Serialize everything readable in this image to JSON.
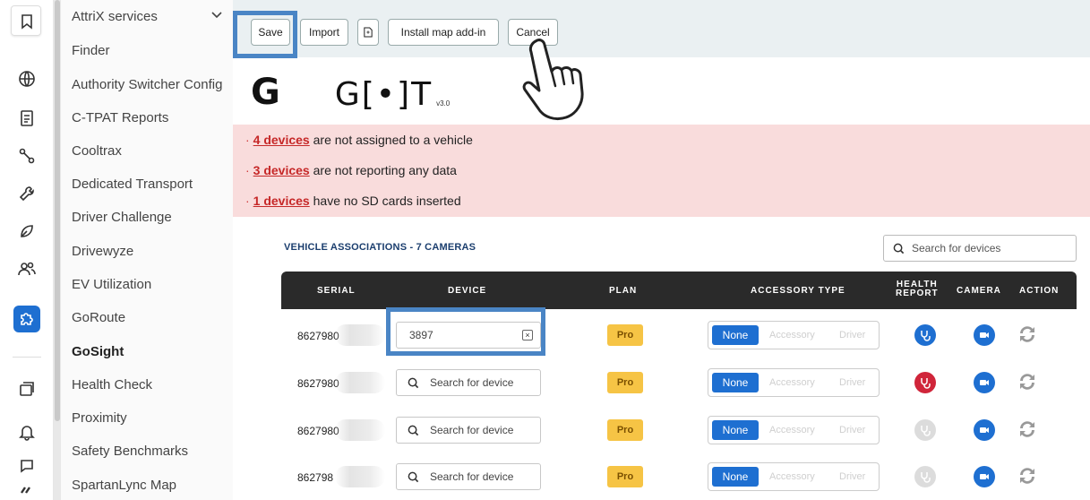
{
  "menu": {
    "items": [
      "AttriX services",
      "Finder",
      "Authority Switcher Config",
      "C-TPAT Reports",
      "Cooltrax",
      "Dedicated Transport",
      "Driver Challenge",
      "Drivewyze",
      "EV Utilization",
      "GoRoute",
      "GoSight",
      "Health Check",
      "Proximity",
      "Safety Benchmarks",
      "SpartanLync Map"
    ]
  },
  "toolbar": {
    "save": "Save",
    "import": "Import",
    "install": "Install map add-in",
    "cancel": "Cancel"
  },
  "logo": {
    "left": "G",
    "right": "G[•]T",
    "version": "v3.0"
  },
  "alerts": [
    {
      "link": "4 devices",
      "text": " are not assigned to a vehicle"
    },
    {
      "link": "3 devices",
      "text": " are not reporting any data"
    },
    {
      "link": "1 devices",
      "text": " have no SD cards inserted"
    }
  ],
  "section": {
    "title": "VEHICLE ASSOCIATIONS - 7 CAMERAS",
    "search_placeholder": "Search for devices"
  },
  "table": {
    "headers": {
      "serial": "SERIAL",
      "device": "DEVICE",
      "plan": "PLAN",
      "accessory": "ACCESSORY TYPE",
      "health1": "HEALTH",
      "health2": "REPORT",
      "camera": "CAMERA",
      "action": "ACTION"
    },
    "rows": [
      {
        "serial": "8627980",
        "device_value": "3897",
        "device_placeholder": "Search for device",
        "plan": "Pro",
        "acc": [
          "None",
          "Accessory",
          "Driver"
        ],
        "health_color": "#1e6fd1"
      },
      {
        "serial": "8627980",
        "device_value": "",
        "device_placeholder": "Search for device",
        "plan": "Pro",
        "acc": [
          "None",
          "Accessory",
          "Driver"
        ],
        "health_color": "#d0253a"
      },
      {
        "serial": "8627980",
        "device_value": "",
        "device_placeholder": "Search for device",
        "plan": "Pro",
        "acc": [
          "None",
          "Accessory",
          "Driver"
        ],
        "health_color": "#dcdcdc"
      },
      {
        "serial": "862798",
        "device_value": "",
        "device_placeholder": "Search for device",
        "plan": "Pro",
        "acc": [
          "None",
          "Accessory",
          "Driver"
        ],
        "health_color": "#dcdcdc"
      }
    ]
  },
  "colors": {
    "accent": "#1e6fd1",
    "alert_bg": "#f9dcdc",
    "header_bg": "#2a2a2a",
    "pro_badge": "#f6c445"
  }
}
